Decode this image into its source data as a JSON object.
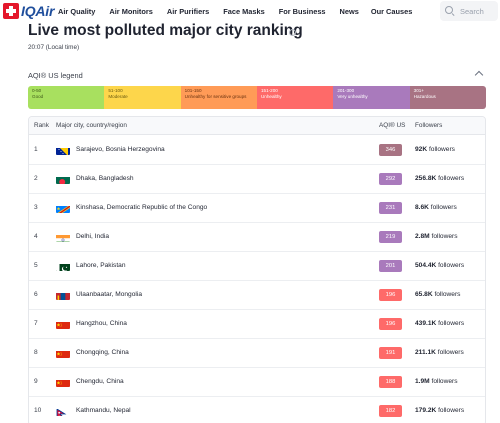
{
  "brand": {
    "name_iq": "IQ",
    "name_air": "Air"
  },
  "nav": [
    "Air Quality",
    "Air Monitors",
    "Air Purifiers",
    "Face Masks",
    "For Business",
    "News",
    "Our Causes"
  ],
  "search": {
    "placeholder": "Search"
  },
  "page": {
    "title": "Live most polluted major city ranking",
    "local_time": "20:07 (Local time)"
  },
  "legend": {
    "title": "AQI® US legend",
    "segments": [
      {
        "range": "0-50",
        "label": "Good",
        "color": "#a8e05f",
        "text_color": "#3f5a1a"
      },
      {
        "range": "51-100",
        "label": "Moderate",
        "color": "#fdd64b",
        "text_color": "#6b5a10"
      },
      {
        "range": "101-150",
        "label": "Unhealthy for sensitive groups",
        "color": "#ff9b57",
        "text_color": "#6b3310"
      },
      {
        "range": "151-200",
        "label": "Unhealthy",
        "color": "#fe6a69",
        "text_color": "#ffffff"
      },
      {
        "range": "201-300",
        "label": "Very unhealthy",
        "color": "#a97abc",
        "text_color": "#ffffff"
      },
      {
        "range": "301+",
        "label": "Hazardous",
        "color": "#a87383",
        "text_color": "#ffffff"
      }
    ]
  },
  "table": {
    "headers": {
      "rank": "Rank",
      "city": "Major city, country/region",
      "aqi": "AQI® US",
      "followers": "Followers"
    },
    "followers_suffix": "followers",
    "rows": [
      {
        "rank": "1",
        "city": "Sarajevo, Bosnia Herzegovina",
        "aqi": "346",
        "aqi_color": "#a87383",
        "followers": "92K",
        "flag": "bosnia"
      },
      {
        "rank": "2",
        "city": "Dhaka, Bangladesh",
        "aqi": "292",
        "aqi_color": "#a97abc",
        "followers": "256.8K",
        "flag": "bangladesh"
      },
      {
        "rank": "3",
        "city": "Kinshasa, Democratic Republic of the Congo",
        "aqi": "231",
        "aqi_color": "#a97abc",
        "followers": "8.6K",
        "flag": "drc"
      },
      {
        "rank": "4",
        "city": "Delhi, India",
        "aqi": "219",
        "aqi_color": "#a97abc",
        "followers": "2.8M",
        "flag": "india"
      },
      {
        "rank": "5",
        "city": "Lahore, Pakistan",
        "aqi": "201",
        "aqi_color": "#a97abc",
        "followers": "504.4K",
        "flag": "pakistan"
      },
      {
        "rank": "6",
        "city": "Ulaanbaatar, Mongolia",
        "aqi": "196",
        "aqi_color": "#fe6a69",
        "followers": "65.8K",
        "flag": "mongolia"
      },
      {
        "rank": "7",
        "city": "Hangzhou, China",
        "aqi": "196",
        "aqi_color": "#fe6a69",
        "followers": "439.1K",
        "flag": "china"
      },
      {
        "rank": "8",
        "city": "Chongqing, China",
        "aqi": "191",
        "aqi_color": "#fe6a69",
        "followers": "211.1K",
        "flag": "china"
      },
      {
        "rank": "9",
        "city": "Chengdu, China",
        "aqi": "188",
        "aqi_color": "#fe6a69",
        "followers": "1.9M",
        "flag": "china"
      },
      {
        "rank": "10",
        "city": "Kathmandu, Nepal",
        "aqi": "182",
        "aqi_color": "#fe6a69",
        "followers": "179.2K",
        "flag": "nepal"
      }
    ]
  }
}
